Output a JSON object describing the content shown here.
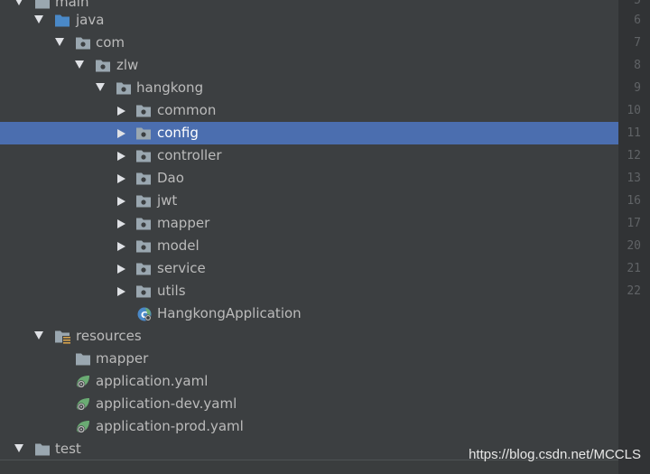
{
  "tree": {
    "root_partial": "main",
    "java": "java",
    "com": "com",
    "zlw": "zlw",
    "hangkong": "hangkong",
    "packages": [
      "common",
      "config",
      "controller",
      "Dao",
      "jwt",
      "mapper",
      "model",
      "service",
      "utils"
    ],
    "selected": "config",
    "app_class": "HangkongApplication",
    "resources": "resources",
    "res_mapper": "mapper",
    "yaml": [
      "application.yaml",
      "application-dev.yaml",
      "application-prod.yaml"
    ],
    "test": "test"
  },
  "gutter": {
    "line_numbers": [
      "5",
      "6",
      "7",
      "8",
      "9",
      "10",
      "11",
      "12",
      "13",
      "16",
      "17",
      "20",
      "21",
      "22"
    ]
  },
  "watermark": "https://blog.csdn.net/MCCLS",
  "colors": {
    "background": "#3c3f41",
    "selection": "#4b6eaf",
    "gutter": "#313335",
    "folder_grey": "#9aa7b0",
    "source_root_blue": "#4a89c8",
    "spring_green": "#6aab73"
  }
}
